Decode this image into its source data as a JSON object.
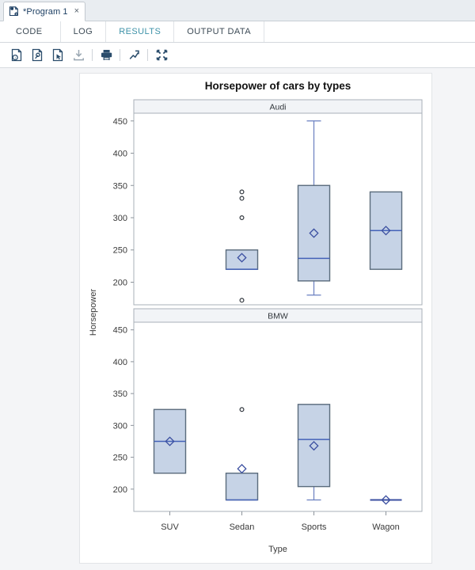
{
  "window": {
    "tab": {
      "title": "*Program 1",
      "close_label": "×",
      "icon": "sas-program-icon"
    }
  },
  "view_tabs": [
    {
      "label": "CODE",
      "active": false
    },
    {
      "label": "LOG",
      "active": false
    },
    {
      "label": "RESULTS",
      "active": true
    },
    {
      "label": "OUTPUT DATA",
      "active": false
    }
  ],
  "toolbar": {
    "buttons": [
      {
        "name": "results-properties-icon",
        "title": "Properties"
      },
      {
        "name": "results-package-icon",
        "title": "Package"
      },
      {
        "name": "results-select-icon",
        "title": "Select"
      },
      {
        "name": "download-icon",
        "title": "Download"
      },
      {
        "name": "print-icon",
        "title": "Print"
      },
      {
        "name": "open-in-new-window-icon",
        "title": "Open in new window"
      },
      {
        "name": "collapse-icon",
        "title": "Collapse"
      }
    ],
    "separators": 3
  },
  "colors": {
    "accent": "#3e92a8",
    "box_fill": "#c6d3e6",
    "box_stroke": "#5a6b7c",
    "median": "#4462b8",
    "whisker": "#6a7fc0",
    "marker": "#3b4fa0",
    "panel_header_bg": "#f2f4f7",
    "axis_text": "#3a3a3a"
  },
  "chart_data": {
    "type": "boxplot",
    "title": "Horsepower of cars by types",
    "xlabel": "Type",
    "ylabel": "Horsepower",
    "categories": [
      "SUV",
      "Sedan",
      "Sports",
      "Wagon"
    ],
    "yticks": [
      200,
      250,
      300,
      350,
      400,
      450
    ],
    "ylim": [
      165,
      462
    ],
    "grid": false,
    "legend": null,
    "panels": [
      {
        "label": "Audi",
        "boxes": [
          {
            "category": "SUV",
            "present": false
          },
          {
            "category": "Sedan",
            "present": true,
            "q1": 220,
            "median": 220,
            "q3": 250,
            "whisker_low": 220,
            "whisker_high": 250,
            "mean": 238,
            "outliers": [
              340,
              330,
              300,
              172
            ]
          },
          {
            "category": "Sports",
            "present": true,
            "q1": 202,
            "median": 237,
            "q3": 350,
            "whisker_low": 180,
            "whisker_high": 450,
            "mean": 276,
            "outliers": []
          },
          {
            "category": "Wagon",
            "present": true,
            "q1": 220,
            "median": 280,
            "q3": 340,
            "whisker_low": 220,
            "whisker_high": 340,
            "mean": 280,
            "outliers": []
          }
        ]
      },
      {
        "label": "BMW",
        "boxes": [
          {
            "category": "SUV",
            "present": true,
            "q1": 225,
            "median": 275,
            "q3": 325,
            "whisker_low": 225,
            "whisker_high": 325,
            "mean": 275,
            "outliers": []
          },
          {
            "category": "Sedan",
            "present": true,
            "q1": 183,
            "median": 183,
            "q3": 225,
            "whisker_low": 183,
            "whisker_high": 225,
            "mean": 232,
            "outliers": [
              325
            ]
          },
          {
            "category": "Sports",
            "present": true,
            "q1": 204,
            "median": 278,
            "q3": 333,
            "whisker_low": 183,
            "whisker_high": 333,
            "mean": 268,
            "outliers": []
          },
          {
            "category": "Wagon",
            "present": true,
            "q1": 183,
            "median": 183,
            "q3": 183,
            "whisker_low": 183,
            "whisker_high": 183,
            "mean": 183,
            "outliers": []
          }
        ]
      }
    ]
  }
}
